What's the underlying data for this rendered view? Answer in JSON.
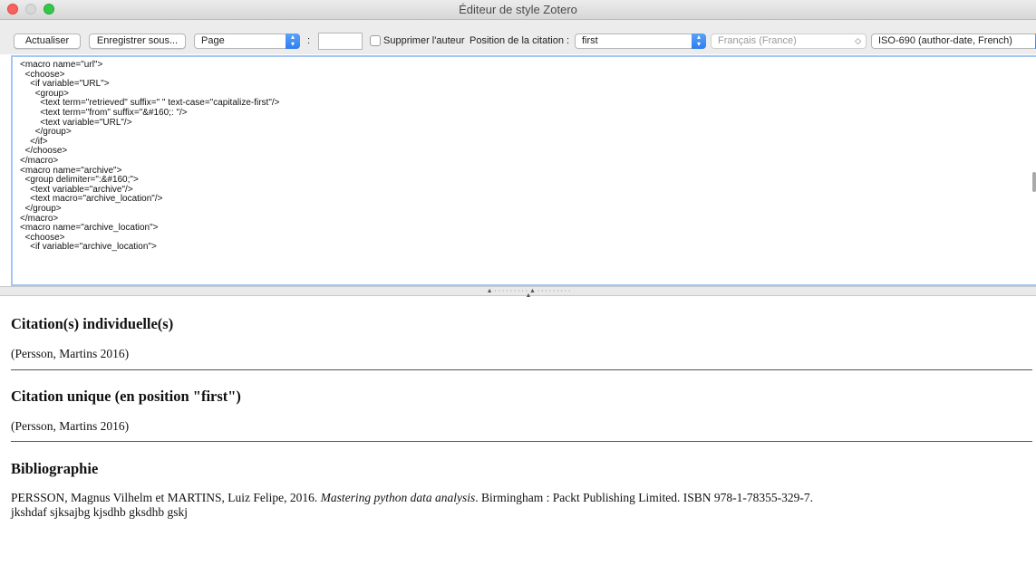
{
  "window": {
    "title": "Éditeur de style Zotero"
  },
  "toolbar": {
    "refresh_label": "Actualiser",
    "save_as_label": "Enregistrer sous...",
    "locator_type": "Page",
    "locator_separator": ":",
    "locator_value": "",
    "suppress_author_label": "Supprimer l'auteur",
    "suppress_author_checked": false,
    "position_label": "Position de la citation :",
    "position_value": "first",
    "locale_value": "Français (France)",
    "style_value": "ISO-690 (author-date, French)"
  },
  "editor": {
    "code": "<macro name=\"url\">\n  <choose>\n    <if variable=\"URL\">\n      <group>\n        <text term=\"retrieved\" suffix=\" \" text-case=\"capitalize-first\"/>\n        <text term=\"from\" suffix=\"&#160;: \"/>\n        <text variable=\"URL\"/>\n      </group>\n    </if>\n  </choose>\n</macro>\n<macro name=\"archive\">\n  <group delimiter=\":&#160;\">\n    <text variable=\"archive\"/>\n    <text macro=\"archive_location\"/>\n  </group>\n</macro>\n<macro name=\"archive_location\">\n  <choose>\n    <if variable=\"archive_location\">"
  },
  "preview": {
    "individual_heading": "Citation(s) individuelle(s)",
    "individual_text": "(Persson, Martins 2016)",
    "single_heading": "Citation unique (en position \"first\")",
    "single_text": "(Persson, Martins 2016)",
    "bibliography_heading": "Bibliographie",
    "bib_before_title": "PERSSON, Magnus Vilhelm et MARTINS, Luiz Felipe, 2016. ",
    "bib_title": "Mastering python data analysis",
    "bib_after_title": ". Birmingham : Packt Publishing Limited. ISBN 978-1-78355-329-7.",
    "bib_line2": "jkshdaf sjksajbg kjsdhb gksdhb gskj"
  },
  "colors": {
    "accent": "#2e7ef0",
    "focus_ring": "#a3c6f2",
    "close": "#fc605c",
    "zoom": "#34c84a"
  }
}
